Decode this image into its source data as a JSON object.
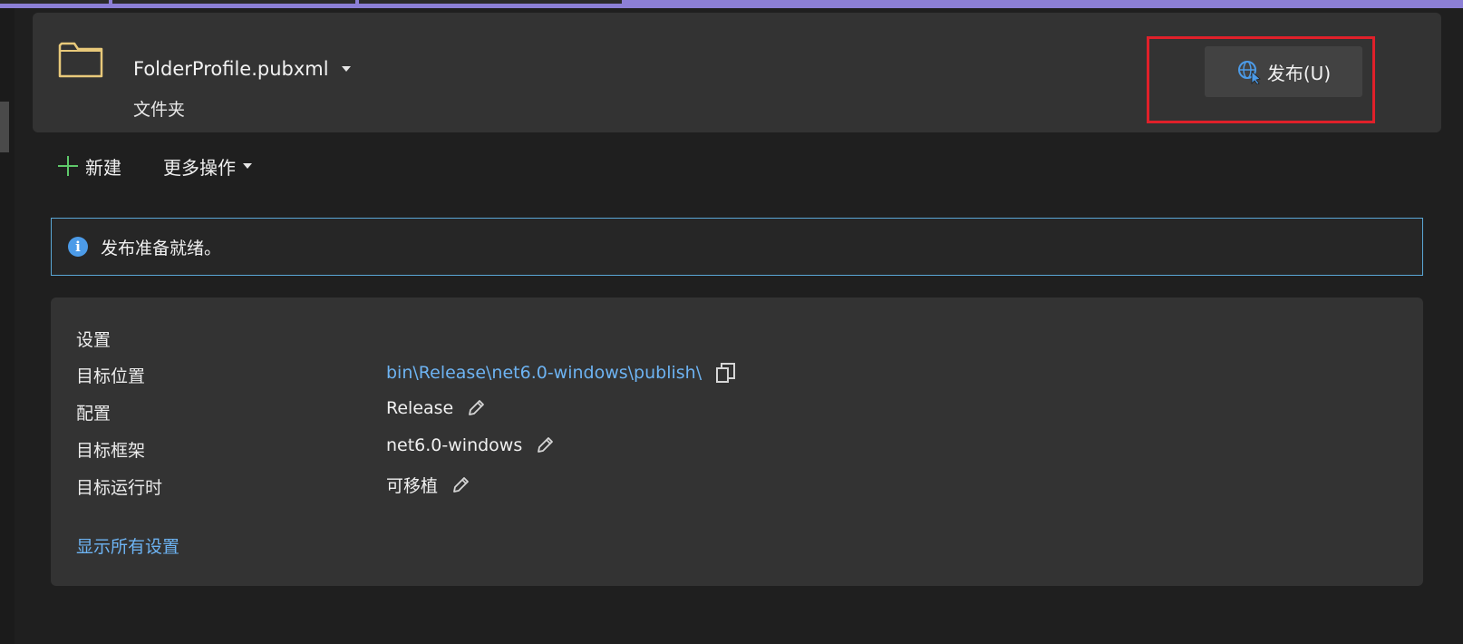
{
  "profile": {
    "name": "FolderProfile.pubxml",
    "type": "文件夹"
  },
  "actions": {
    "publish_label": "发布(U)",
    "new_label": "新建",
    "more_label": "更多操作"
  },
  "info": {
    "message": "发布准备就绪。"
  },
  "settings": {
    "title": "设置",
    "rows": [
      {
        "label": "目标位置",
        "value": "bin\\Release\\net6.0-windows\\publish\\"
      },
      {
        "label": "配置",
        "value": "Release"
      },
      {
        "label": "目标框架",
        "value": "net6.0-windows"
      },
      {
        "label": "目标运行时",
        "value": "可移植"
      }
    ],
    "show_all": "显示所有设置"
  },
  "colors": {
    "accent": "#8c7fd6",
    "link": "#6db3f2",
    "highlight": "#e0202a",
    "info_border": "#5aa7d6"
  }
}
